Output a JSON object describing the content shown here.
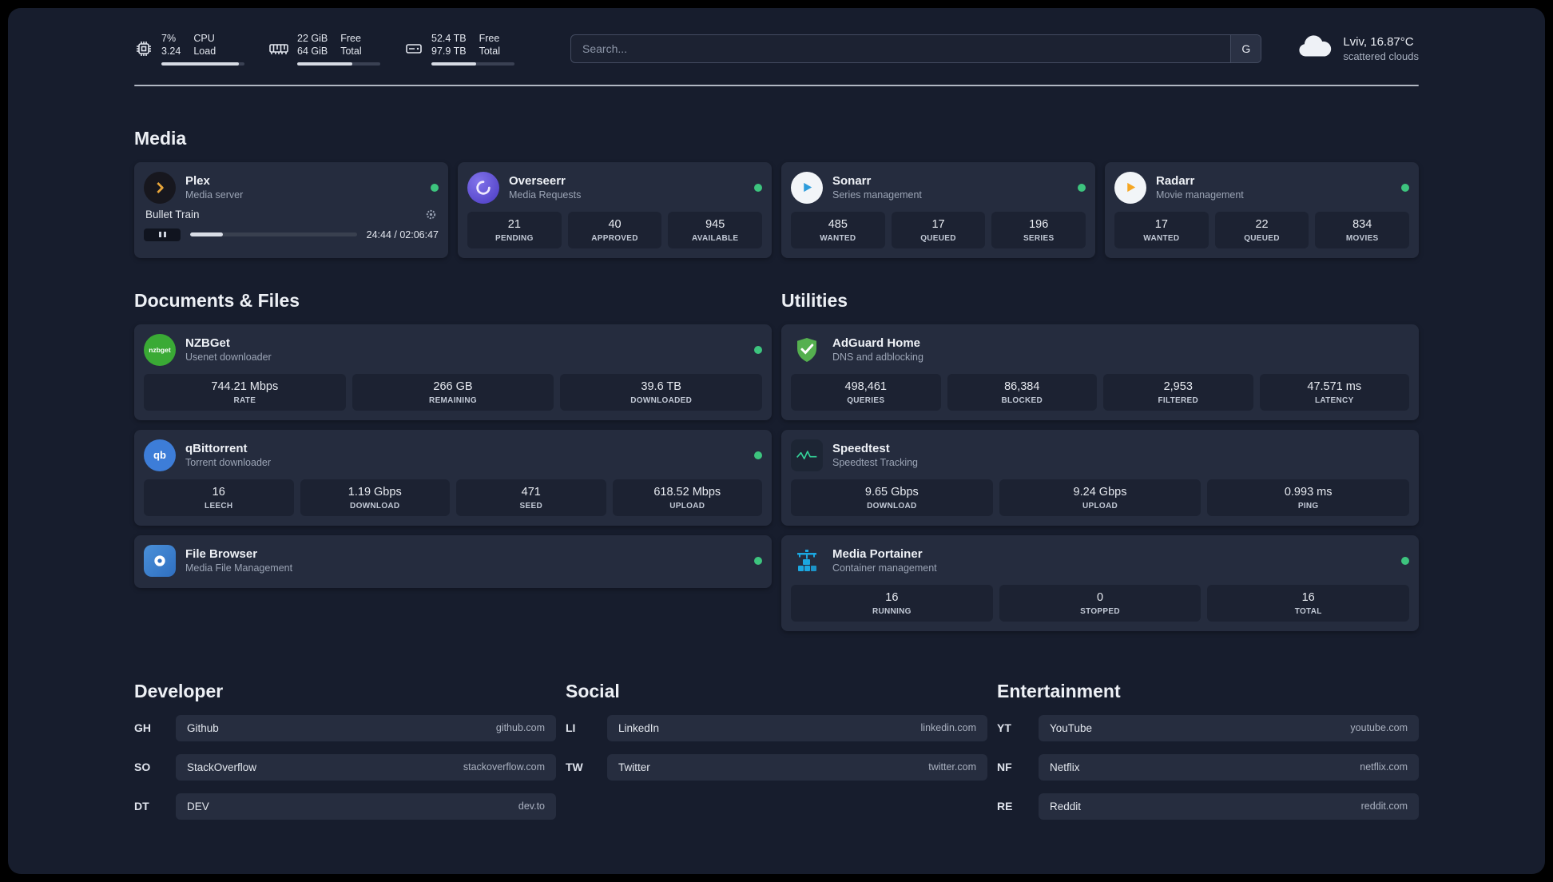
{
  "topbar": {
    "cpu": {
      "icon": "cpu-icon",
      "value": "7%",
      "sub": "3.24",
      "label_top": "CPU",
      "label_bottom": "Load",
      "bar_percent": 93
    },
    "memory": {
      "icon": "ram-icon",
      "value": "22 GiB",
      "sub": "64 GiB",
      "label_top": "Free",
      "label_bottom": "Total",
      "bar_percent": 66
    },
    "disk": {
      "icon": "disk-icon",
      "value": "52.4 TB",
      "sub": "97.9 TB",
      "label_top": "Free",
      "label_bottom": "Total",
      "bar_percent": 54
    },
    "search": {
      "placeholder": "Search...",
      "button": "G"
    },
    "weather": {
      "location": "Lviv, 16.87°C",
      "condition": "scattered clouds"
    }
  },
  "media": {
    "heading": "Media",
    "plex": {
      "name": "Plex",
      "subtitle": "Media server",
      "online": true,
      "now_playing": "Bullet Train",
      "time": "24:44 / 02:06:47",
      "progress_percent": 19.5
    },
    "apps": [
      {
        "name": "Overseerr",
        "subtitle": "Media Requests",
        "online": true,
        "icon": "overseerr-icon",
        "stats": [
          {
            "value": "21",
            "label": "PENDING"
          },
          {
            "value": "40",
            "label": "APPROVED"
          },
          {
            "value": "945",
            "label": "AVAILABLE"
          }
        ]
      },
      {
        "name": "Sonarr",
        "subtitle": "Series management",
        "online": true,
        "icon": "sonarr-icon",
        "stats": [
          {
            "value": "485",
            "label": "WANTED"
          },
          {
            "value": "17",
            "label": "QUEUED"
          },
          {
            "value": "196",
            "label": "SERIES"
          }
        ]
      },
      {
        "name": "Radarr",
        "subtitle": "Movie management",
        "online": true,
        "icon": "radarr-icon",
        "stats": [
          {
            "value": "17",
            "label": "WANTED"
          },
          {
            "value": "22",
            "label": "QUEUED"
          },
          {
            "value": "834",
            "label": "MOVIES"
          }
        ]
      }
    ]
  },
  "documents": {
    "heading": "Documents & Files",
    "apps": [
      {
        "name": "NZBGet",
        "subtitle": "Usenet downloader",
        "online": true,
        "icon": "nzbget-icon",
        "icon_text": "nzbget",
        "stats": [
          {
            "value": "744.21 Mbps",
            "label": "RATE"
          },
          {
            "value": "266 GB",
            "label": "REMAINING"
          },
          {
            "value": "39.6 TB",
            "label": "DOWNLOADED"
          }
        ]
      },
      {
        "name": "qBittorrent",
        "subtitle": "Torrent downloader",
        "online": true,
        "icon": "qbittorrent-icon",
        "icon_text": "qb",
        "stats": [
          {
            "value": "16",
            "label": "LEECH"
          },
          {
            "value": "1.19 Gbps",
            "label": "DOWNLOAD"
          },
          {
            "value": "471",
            "label": "SEED"
          },
          {
            "value": "618.52 Mbps",
            "label": "UPLOAD"
          }
        ]
      },
      {
        "name": "File Browser",
        "subtitle": "Media File Management",
        "online": true,
        "icon": "filebrowser-icon",
        "stats": []
      }
    ]
  },
  "utilities": {
    "heading": "Utilities",
    "apps": [
      {
        "name": "AdGuard Home",
        "subtitle": "DNS and adblocking",
        "online": false,
        "icon": "adguard-icon",
        "stats": [
          {
            "value": "498,461",
            "label": "QUERIES"
          },
          {
            "value": "86,384",
            "label": "BLOCKED"
          },
          {
            "value": "2,953",
            "label": "FILTERED"
          },
          {
            "value": "47.571 ms",
            "label": "LATENCY"
          }
        ]
      },
      {
        "name": "Speedtest",
        "subtitle": "Speedtest Tracking",
        "online": false,
        "icon": "speedtest-icon",
        "stats": [
          {
            "value": "9.65 Gbps",
            "label": "DOWNLOAD"
          },
          {
            "value": "9.24 Gbps",
            "label": "UPLOAD"
          },
          {
            "value": "0.993 ms",
            "label": "PING"
          }
        ]
      },
      {
        "name": "Media Portainer",
        "subtitle": "Container management",
        "online": true,
        "icon": "portainer-icon",
        "stats": [
          {
            "value": "16",
            "label": "RUNNING"
          },
          {
            "value": "0",
            "label": "STOPPED"
          },
          {
            "value": "16",
            "label": "TOTAL"
          }
        ]
      }
    ]
  },
  "bookmarks": [
    {
      "heading": "Developer",
      "items": [
        {
          "abbr": "GH",
          "name": "Github",
          "url": "github.com"
        },
        {
          "abbr": "SO",
          "name": "StackOverflow",
          "url": "stackoverflow.com"
        },
        {
          "abbr": "DT",
          "name": "DEV",
          "url": "dev.to"
        }
      ]
    },
    {
      "heading": "Social",
      "items": [
        {
          "abbr": "LI",
          "name": "LinkedIn",
          "url": "linkedin.com"
        },
        {
          "abbr": "TW",
          "name": "Twitter",
          "url": "twitter.com"
        }
      ]
    },
    {
      "heading": "Entertainment",
      "items": [
        {
          "abbr": "YT",
          "name": "YouTube",
          "url": "youtube.com"
        },
        {
          "abbr": "NF",
          "name": "Netflix",
          "url": "netflix.com"
        },
        {
          "abbr": "RE",
          "name": "Reddit",
          "url": "reddit.com"
        }
      ]
    }
  ]
}
